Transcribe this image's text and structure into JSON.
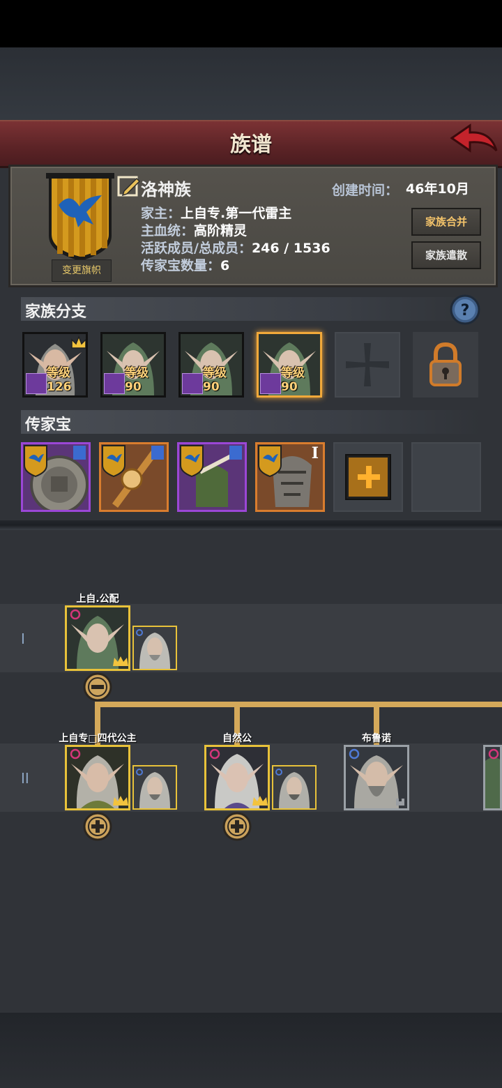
{
  "header": {
    "title": "族谱"
  },
  "clan": {
    "name": "洛神族",
    "founded_label": "创建时间：",
    "founded_value": "46年10月",
    "change_banner_label": "变更旗帜",
    "info": [
      {
        "label": "家主：",
        "value": "上自专.第一代雷主"
      },
      {
        "label": "主血统：",
        "value": "高阶精灵"
      },
      {
        "label": "活跃成员/总成员：",
        "value": "246 / 1536"
      },
      {
        "label": "传家宝数量：",
        "value": "6"
      }
    ],
    "merge_label": "家族合并",
    "disband_label": "家族遣散"
  },
  "branches": {
    "title": "家族分支",
    "items": [
      {
        "level": "等级126",
        "leader": true
      },
      {
        "level": "等级90"
      },
      {
        "level": "等级90"
      },
      {
        "level": "等级90",
        "active": true
      }
    ]
  },
  "heirlooms": {
    "title": "传家宝",
    "extra_mark": "I"
  },
  "tree": {
    "generations": [
      {
        "label": "I",
        "members": [
          {
            "name": "上自.公配"
          }
        ]
      },
      {
        "label": "II",
        "members": [
          {
            "name": "上自专□四代公主"
          },
          {
            "name": "自然公"
          },
          {
            "name": "布鲁诺"
          }
        ]
      }
    ]
  },
  "colors": {
    "title_bar": "#6b2a2d",
    "gold_frame": "#e8c23a",
    "tree_line": "#d4a95a",
    "level_text": "#ffd27a",
    "merge_text": "#f3c36a"
  }
}
